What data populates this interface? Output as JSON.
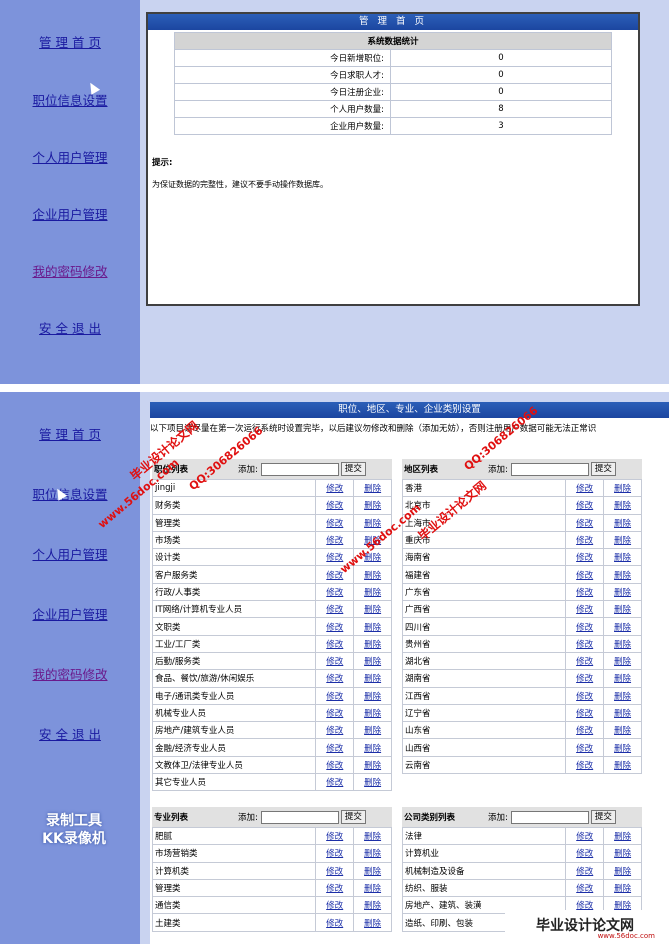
{
  "sidebar": {
    "items": [
      "管 理 首 页",
      "职位信息设置",
      "个人用户管理",
      "企业用户管理",
      "我的密码修改",
      "安 全 退 出"
    ]
  },
  "screen1": {
    "title": "管 理 首 页",
    "stats_title": "系统数据统计",
    "stats": [
      {
        "label": "今日新增职位:",
        "value": "0"
      },
      {
        "label": "今日求职人才:",
        "value": "0"
      },
      {
        "label": "今日注册企业:",
        "value": "0"
      },
      {
        "label": "个人用户数量:",
        "value": "8"
      },
      {
        "label": "企业用户数量:",
        "value": "3"
      }
    ],
    "tip_label": "提示:",
    "tip_text": "为保证数据的完整性，建议不要手动操作数据库。"
  },
  "screen2": {
    "title": "职位、地区、专业、企业类别设置",
    "note": "以下项目请尽量在第一次运行系统时设置完毕，以后建议勿修改和删除（添加无妨），否则注册用户数据可能无法正常识",
    "add_label": "添加:",
    "submit_label": "提交",
    "edit_label": "修改",
    "delete_label": "删除",
    "job_list": {
      "title": "职位列表",
      "items": [
        "jingji",
        "财务类",
        "管理类",
        "市场类",
        "设计类",
        "客户服务类",
        "行政/人事类",
        "IT网络/计算机专业人员",
        "文职类",
        "工业/工厂类",
        "后勤/服务类",
        "食品、餐饮/旅游/休闲娱乐",
        "电子/通讯类专业人员",
        "机械专业人员",
        "房地产/建筑专业人员",
        "金融/经济专业人员",
        "文教体卫/法律专业人员",
        "其它专业人员"
      ]
    },
    "region_list": {
      "title": "地区列表",
      "items": [
        "香港",
        "北京市",
        "上海市",
        "重庆市",
        "海南省",
        "福建省",
        "广东省",
        "广西省",
        "四川省",
        "贵州省",
        "湖北省",
        "湖南省",
        "江西省",
        "辽宁省",
        "山东省",
        "山西省",
        "云南省"
      ]
    },
    "major_list": {
      "title": "专业列表",
      "items": [
        "肥腻",
        "市场营销类",
        "计算机类",
        "管理类",
        "通信类",
        "土建类"
      ]
    },
    "company_list": {
      "title": "公司类别列表",
      "items": [
        "法律",
        "计算机业",
        "机械制造及设备",
        "纺织、服装",
        "房地产、建筑、装潢",
        "造纸、印刷、包装"
      ]
    }
  },
  "watermarks": {
    "site_url": "www.56doc.com",
    "qq": "QQ:306826066",
    "brand": "毕业设计论文网",
    "recorder": "录制工具",
    "recorder2": "KK录像机",
    "logo_text": "毕业设计论文网",
    "logo_url": "www.56doc.com"
  },
  "colors": {
    "sidebar": "#7d93db",
    "background": "#c9d3f0",
    "titlebar": "#1c46a0",
    "link": "#1c2fa8"
  }
}
